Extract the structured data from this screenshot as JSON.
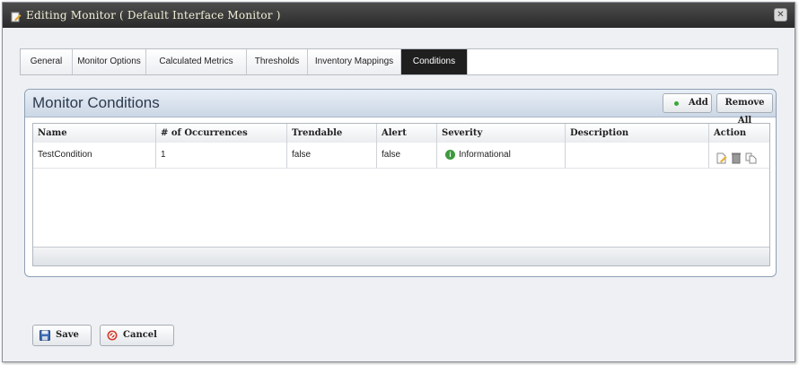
{
  "window": {
    "title": "Editing Monitor ( Default Interface Monitor )"
  },
  "tabs": [
    {
      "label": "General",
      "active": false
    },
    {
      "label": "Monitor Options",
      "active": false
    },
    {
      "label": "Calculated Metrics",
      "active": false
    },
    {
      "label": "Thresholds",
      "active": false
    },
    {
      "label": "Inventory Mappings",
      "active": false
    },
    {
      "label": "Conditions",
      "active": true
    }
  ],
  "panel": {
    "title": "Monitor Conditions",
    "add_label": "Add",
    "remove_all_label": "Remove All"
  },
  "table": {
    "columns": [
      "Name",
      "# of Occurrences",
      "Trendable",
      "Alert",
      "Severity",
      "Description",
      "Action"
    ],
    "rows": [
      {
        "name": "TestCondition",
        "occurrences": "1",
        "trendable": "false",
        "alert": "false",
        "severity": "Informational",
        "description": "",
        "actions": [
          "edit-icon",
          "delete-icon",
          "copy-icon"
        ]
      }
    ]
  },
  "footer": {
    "save_label": "Save",
    "cancel_label": "Cancel"
  },
  "colors": {
    "active_tab": "#1f1f1f",
    "severity_informational": "#3d9a3d",
    "add_dot": "#3aa83a",
    "cancel_icon": "#d33a2c"
  }
}
